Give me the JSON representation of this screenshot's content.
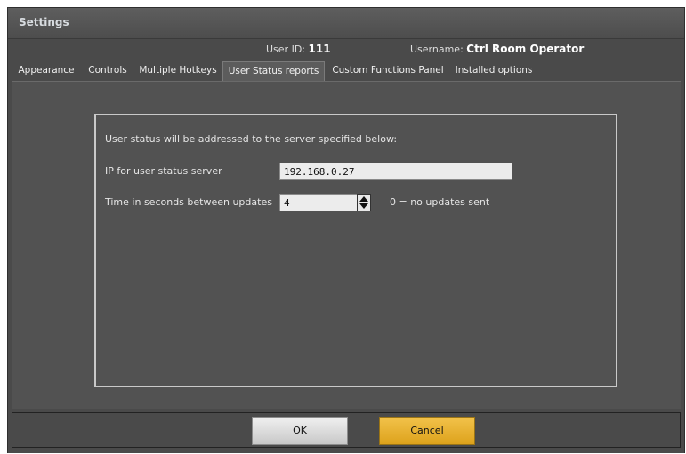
{
  "window": {
    "title": "Settings"
  },
  "user": {
    "id_label": "User ID:",
    "id_value": "111",
    "username_label": "Username:",
    "username_value": "Ctrl Room Operator"
  },
  "tabs": [
    {
      "label": "Appearance",
      "active": false
    },
    {
      "label": "Controls",
      "active": false
    },
    {
      "label": "Multiple Hotkeys",
      "active": false
    },
    {
      "label": "User Status reports",
      "active": true
    },
    {
      "label": "Custom Functions Panel",
      "active": false
    },
    {
      "label": "Installed options",
      "active": false
    }
  ],
  "panel": {
    "description": "User status will be addressed to the server specified below:",
    "ip_label": "IP for user status server",
    "ip_value": "192.168.0.27",
    "interval_label": "Time in seconds between updates",
    "interval_value": "4",
    "interval_hint": "0 = no updates sent"
  },
  "buttons": {
    "ok_label": "OK",
    "cancel_label": "Cancel"
  },
  "colors": {
    "background": "#4a4a4a",
    "cancel_accent": "#e8b030"
  }
}
